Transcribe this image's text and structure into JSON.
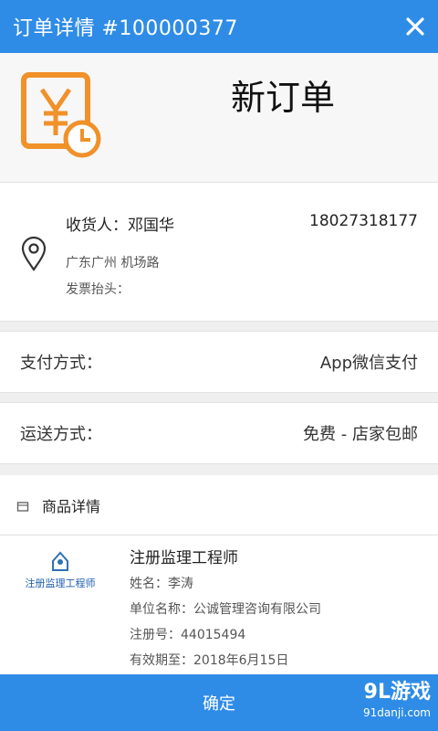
{
  "header": {
    "title": "订单详情 #100000377",
    "close_icon": "close-icon"
  },
  "status": {
    "label": "新订单",
    "icon": "yen-clock-icon",
    "icon_color": "#f0912a"
  },
  "receiver": {
    "name": "收货人：邓国华",
    "phone": "18027318177",
    "address": "广东广州 机场路",
    "invoice": "发票抬头：",
    "icon": "location-pin-icon"
  },
  "payment": {
    "label": "支付方式：",
    "value": "App微信支付"
  },
  "shipping": {
    "label": "运送方式：",
    "value": "免费 - 店家包邮"
  },
  "goods_header": {
    "label": "商品详情",
    "icon": "cart-icon"
  },
  "goods": {
    "thumb_text": "注册监理工程师",
    "title": "注册监理工程师",
    "lines": [
      "姓名：李涛",
      "单位名称：公诚管理咨询有限公司",
      "注册号：44015494",
      "有效期至：2018年6月15日"
    ]
  },
  "footer": {
    "confirm_label": "确定"
  },
  "watermark": {
    "brand": "9L游戏",
    "domain": "91danji.com"
  },
  "colors": {
    "primary": "#2f8ce6",
    "accent": "#f0912a"
  }
}
